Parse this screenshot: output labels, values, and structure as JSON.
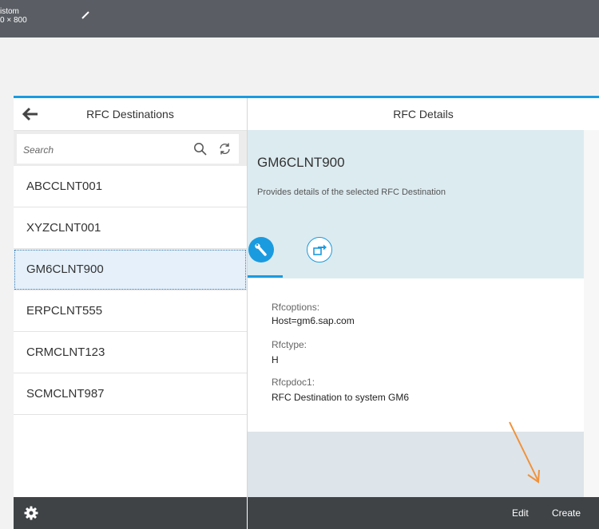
{
  "device": {
    "label_line1": "istom",
    "label_line2": "0 × 800"
  },
  "master": {
    "title": "RFC Destinations",
    "search_placeholder": "Search",
    "items": [
      {
        "label": "ABCCLNT001",
        "selected": false
      },
      {
        "label": "XYZCLNT001",
        "selected": false
      },
      {
        "label": "GM6CLNT900",
        "selected": true
      },
      {
        "label": "ERPCLNT555",
        "selected": false
      },
      {
        "label": "CRMCLNT123",
        "selected": false
      },
      {
        "label": "SCMCLNT987",
        "selected": false
      }
    ]
  },
  "detail": {
    "title": "RFC Details",
    "object_title": "GM6CLNT900",
    "object_subtitle": "Provides details of the selected RFC Destination",
    "fields": [
      {
        "label": "Rfcoptions:",
        "value": "Host=gm6.sap.com"
      },
      {
        "label": "Rfctype:",
        "value": "H"
      },
      {
        "label": "Rfcpdoc1:",
        "value": "RFC Destination to system GM6"
      }
    ]
  },
  "footer": {
    "edit_label": "Edit",
    "create_label": "Create"
  },
  "colors": {
    "accent": "#1a9be0",
    "header_bg": "#dcebf0",
    "footer_bg": "#3f4346",
    "annotation": "#f0923a"
  }
}
